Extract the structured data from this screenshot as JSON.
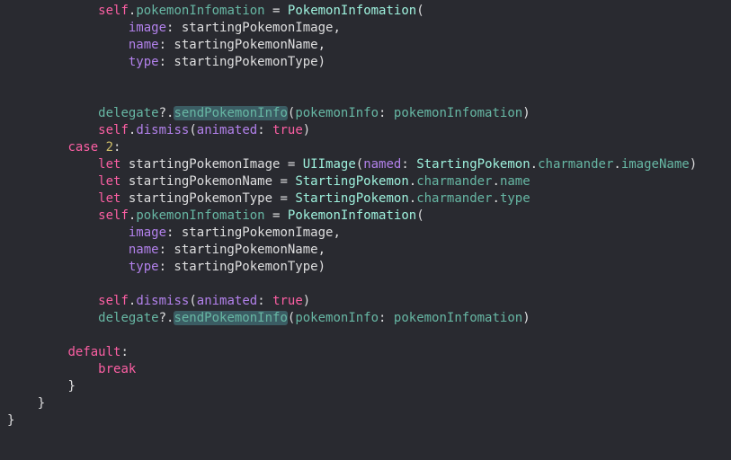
{
  "editor": {
    "colors": {
      "background": "#292a30",
      "plain": "#dfdfe0",
      "keyword": "#fc5fa3",
      "number": "#d0bf69",
      "type": "#9ef1dd",
      "property": "#67b7a4",
      "label": "#b281eb",
      "highlight": "#3b5c63"
    },
    "lines": [
      {
        "indent": "            ",
        "tokens": [
          {
            "t": "self",
            "c": "kw"
          },
          {
            "t": ".",
            "c": "plain"
          },
          {
            "t": "pokemonInfomation",
            "c": "prop"
          },
          {
            "t": " = ",
            "c": "plain"
          },
          {
            "t": "PokemonInfomation",
            "c": "type"
          },
          {
            "t": "(",
            "c": "plain"
          }
        ]
      },
      {
        "indent": "                ",
        "tokens": [
          {
            "t": "image",
            "c": "label"
          },
          {
            "t": ": startingPokemonImage,",
            "c": "plain"
          }
        ]
      },
      {
        "indent": "                ",
        "tokens": [
          {
            "t": "name",
            "c": "label"
          },
          {
            "t": ": startingPokemonName,",
            "c": "plain"
          }
        ]
      },
      {
        "indent": "                ",
        "tokens": [
          {
            "t": "type",
            "c": "label"
          },
          {
            "t": ": startingPokemonType)",
            "c": "plain"
          }
        ]
      },
      {
        "indent": "",
        "tokens": []
      },
      {
        "indent": "",
        "tokens": []
      },
      {
        "indent": "            ",
        "tokens": [
          {
            "t": "delegate",
            "c": "prop"
          },
          {
            "t": "?.",
            "c": "plain"
          },
          {
            "t": "sendPokemonInfo",
            "c": "hl"
          },
          {
            "t": "(",
            "c": "plain"
          },
          {
            "t": "pokemonInfo",
            "c": "prop"
          },
          {
            "t": ": ",
            "c": "plain"
          },
          {
            "t": "pokemonInfomation",
            "c": "prop"
          },
          {
            "t": ")",
            "c": "plain"
          }
        ]
      },
      {
        "indent": "            ",
        "tokens": [
          {
            "t": "self",
            "c": "kw"
          },
          {
            "t": ".",
            "c": "plain"
          },
          {
            "t": "dismiss",
            "c": "param"
          },
          {
            "t": "(",
            "c": "plain"
          },
          {
            "t": "animated",
            "c": "param"
          },
          {
            "t": ": ",
            "c": "plain"
          },
          {
            "t": "true",
            "c": "kw"
          },
          {
            "t": ")",
            "c": "plain"
          }
        ]
      },
      {
        "indent": "        ",
        "tokens": [
          {
            "t": "case",
            "c": "kw"
          },
          {
            "t": " ",
            "c": "plain"
          },
          {
            "t": "2",
            "c": "num"
          },
          {
            "t": ":",
            "c": "plain"
          }
        ]
      },
      {
        "indent": "            ",
        "tokens": [
          {
            "t": "let",
            "c": "kw"
          },
          {
            "t": " startingPokemonImage = ",
            "c": "plain"
          },
          {
            "t": "UIImage",
            "c": "type"
          },
          {
            "t": "(",
            "c": "plain"
          },
          {
            "t": "named",
            "c": "param"
          },
          {
            "t": ": ",
            "c": "plain"
          },
          {
            "t": "StartingPokemon",
            "c": "type"
          },
          {
            "t": ".",
            "c": "plain"
          },
          {
            "t": "charmander",
            "c": "prop"
          },
          {
            "t": ".",
            "c": "plain"
          },
          {
            "t": "imageName",
            "c": "prop"
          },
          {
            "t": ")",
            "c": "plain"
          }
        ]
      },
      {
        "indent": "            ",
        "tokens": [
          {
            "t": "let",
            "c": "kw"
          },
          {
            "t": " startingPokemonName = ",
            "c": "plain"
          },
          {
            "t": "StartingPokemon",
            "c": "type"
          },
          {
            "t": ".",
            "c": "plain"
          },
          {
            "t": "charmander",
            "c": "prop"
          },
          {
            "t": ".",
            "c": "plain"
          },
          {
            "t": "name",
            "c": "prop"
          }
        ]
      },
      {
        "indent": "            ",
        "tokens": [
          {
            "t": "let",
            "c": "kw"
          },
          {
            "t": " startingPokemonType = ",
            "c": "plain"
          },
          {
            "t": "StartingPokemon",
            "c": "type"
          },
          {
            "t": ".",
            "c": "plain"
          },
          {
            "t": "charmander",
            "c": "prop"
          },
          {
            "t": ".",
            "c": "plain"
          },
          {
            "t": "type",
            "c": "prop"
          }
        ]
      },
      {
        "indent": "            ",
        "tokens": [
          {
            "t": "self",
            "c": "kw"
          },
          {
            "t": ".",
            "c": "plain"
          },
          {
            "t": "pokemonInfomation",
            "c": "prop"
          },
          {
            "t": " = ",
            "c": "plain"
          },
          {
            "t": "PokemonInfomation",
            "c": "type"
          },
          {
            "t": "(",
            "c": "plain"
          }
        ]
      },
      {
        "indent": "                ",
        "tokens": [
          {
            "t": "image",
            "c": "label"
          },
          {
            "t": ": startingPokemonImage,",
            "c": "plain"
          }
        ]
      },
      {
        "indent": "                ",
        "tokens": [
          {
            "t": "name",
            "c": "label"
          },
          {
            "t": ": startingPokemonName,",
            "c": "plain"
          }
        ]
      },
      {
        "indent": "                ",
        "tokens": [
          {
            "t": "type",
            "c": "label"
          },
          {
            "t": ": startingPokemonType)",
            "c": "plain"
          }
        ]
      },
      {
        "indent": "",
        "tokens": []
      },
      {
        "indent": "            ",
        "tokens": [
          {
            "t": "self",
            "c": "kw"
          },
          {
            "t": ".",
            "c": "plain"
          },
          {
            "t": "dismiss",
            "c": "param"
          },
          {
            "t": "(",
            "c": "plain"
          },
          {
            "t": "animated",
            "c": "param"
          },
          {
            "t": ": ",
            "c": "plain"
          },
          {
            "t": "true",
            "c": "kw"
          },
          {
            "t": ")",
            "c": "plain"
          }
        ]
      },
      {
        "indent": "            ",
        "tokens": [
          {
            "t": "delegate",
            "c": "prop"
          },
          {
            "t": "?.",
            "c": "plain"
          },
          {
            "t": "sendPokemonInfo",
            "c": "hl"
          },
          {
            "t": "(",
            "c": "plain"
          },
          {
            "t": "pokemonInfo",
            "c": "prop"
          },
          {
            "t": ": ",
            "c": "plain"
          },
          {
            "t": "pokemonInfomation",
            "c": "prop"
          },
          {
            "t": ")",
            "c": "plain"
          }
        ]
      },
      {
        "indent": "",
        "tokens": []
      },
      {
        "indent": "        ",
        "tokens": [
          {
            "t": "default",
            "c": "kw"
          },
          {
            "t": ":",
            "c": "plain"
          }
        ]
      },
      {
        "indent": "            ",
        "tokens": [
          {
            "t": "break",
            "c": "kw"
          }
        ]
      },
      {
        "indent": "        ",
        "tokens": [
          {
            "t": "}",
            "c": "plain"
          }
        ]
      },
      {
        "indent": "    ",
        "tokens": [
          {
            "t": "}",
            "c": "plain"
          }
        ]
      },
      {
        "indent": "",
        "tokens": [
          {
            "t": "}",
            "c": "plain"
          }
        ]
      }
    ]
  }
}
